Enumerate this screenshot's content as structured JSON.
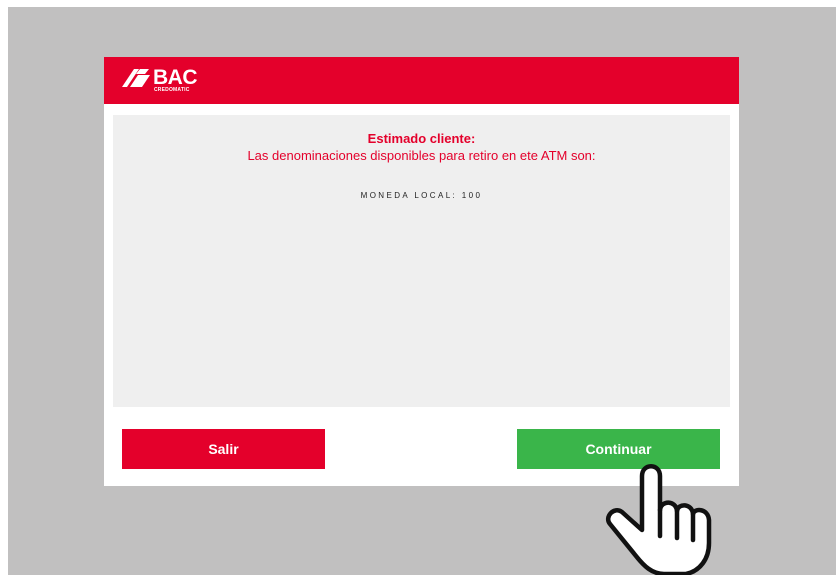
{
  "brand": {
    "name": "BAC",
    "sub": "CREDOMATIC",
    "color": "#e4002b"
  },
  "message": {
    "title": "Estimado cliente:",
    "body": "Las denominaciones disponibles para retiro en ete ATM son:",
    "denominations": "MONEDA LOCAL: 100"
  },
  "buttons": {
    "exit_label": "Salir",
    "exit_color": "#e4002b",
    "continue_label": "Continuar",
    "continue_color": "#3ab54a"
  },
  "icons": {
    "logo": "bac-logo-icon",
    "pointer": "hand-pointer-icon"
  }
}
